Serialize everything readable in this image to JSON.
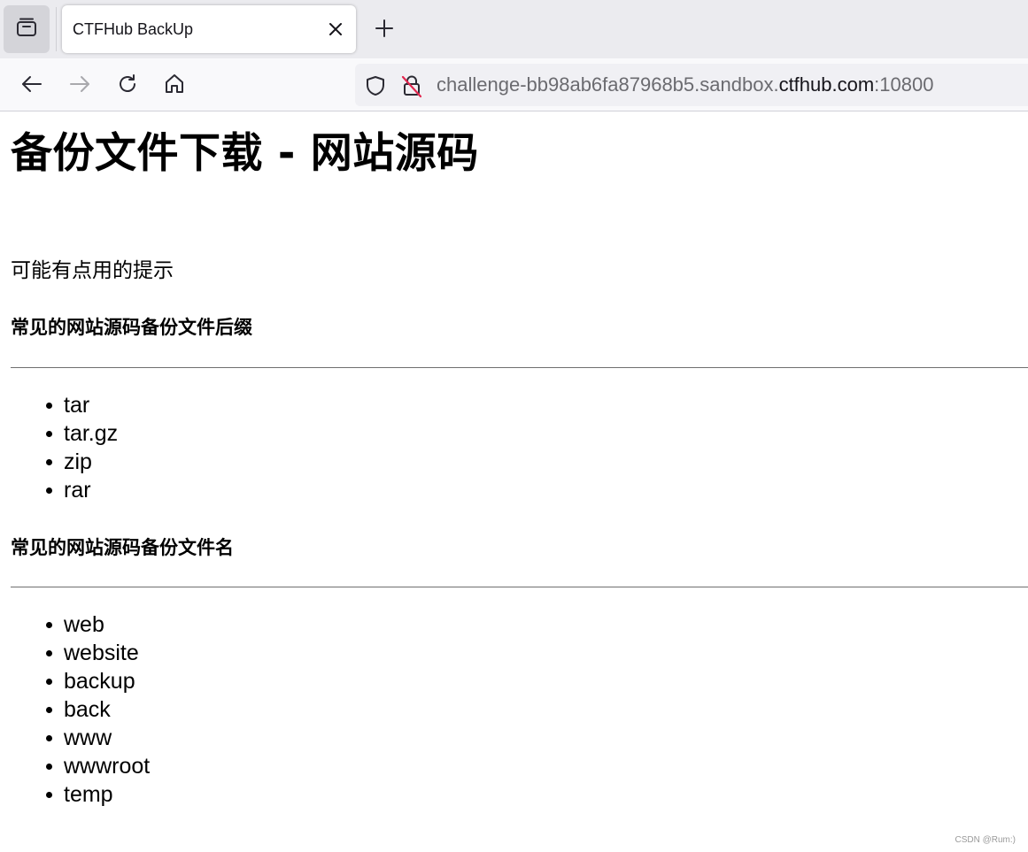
{
  "browser": {
    "tab": {
      "title": "CTFHub BackUp"
    },
    "url": {
      "prefix": "challenge-bb98ab6fa87968b5.sandbox.",
      "host": "ctfhub.com",
      "port": ":10800"
    }
  },
  "page": {
    "title": "备份文件下载 - 网站源码",
    "hint": "可能有点用的提示",
    "sections": [
      {
        "heading": "常见的网站源码备份文件后缀",
        "items": [
          "tar",
          "tar.gz",
          "zip",
          "rar"
        ]
      },
      {
        "heading": "常见的网站源码备份文件名",
        "items": [
          "web",
          "website",
          "backup",
          "back",
          "www",
          "wwwroot",
          "temp"
        ]
      }
    ]
  },
  "watermark": "CSDN @Rum:)",
  "icons": {
    "tab_list": "tab-list-icon",
    "close": "close-icon",
    "new_tab": "plus-icon",
    "back": "arrow-left-icon",
    "forward": "arrow-right-icon",
    "reload": "reload-icon",
    "home": "home-icon",
    "shield": "shield-icon",
    "insecure_lock": "insecure-lock-icon"
  },
  "colors": {
    "chrome_bg": "#ebebef",
    "toolbar_bg": "#f9f9fb",
    "urlbar_bg": "#f0f0f4",
    "insecure_red": "#e22850"
  }
}
